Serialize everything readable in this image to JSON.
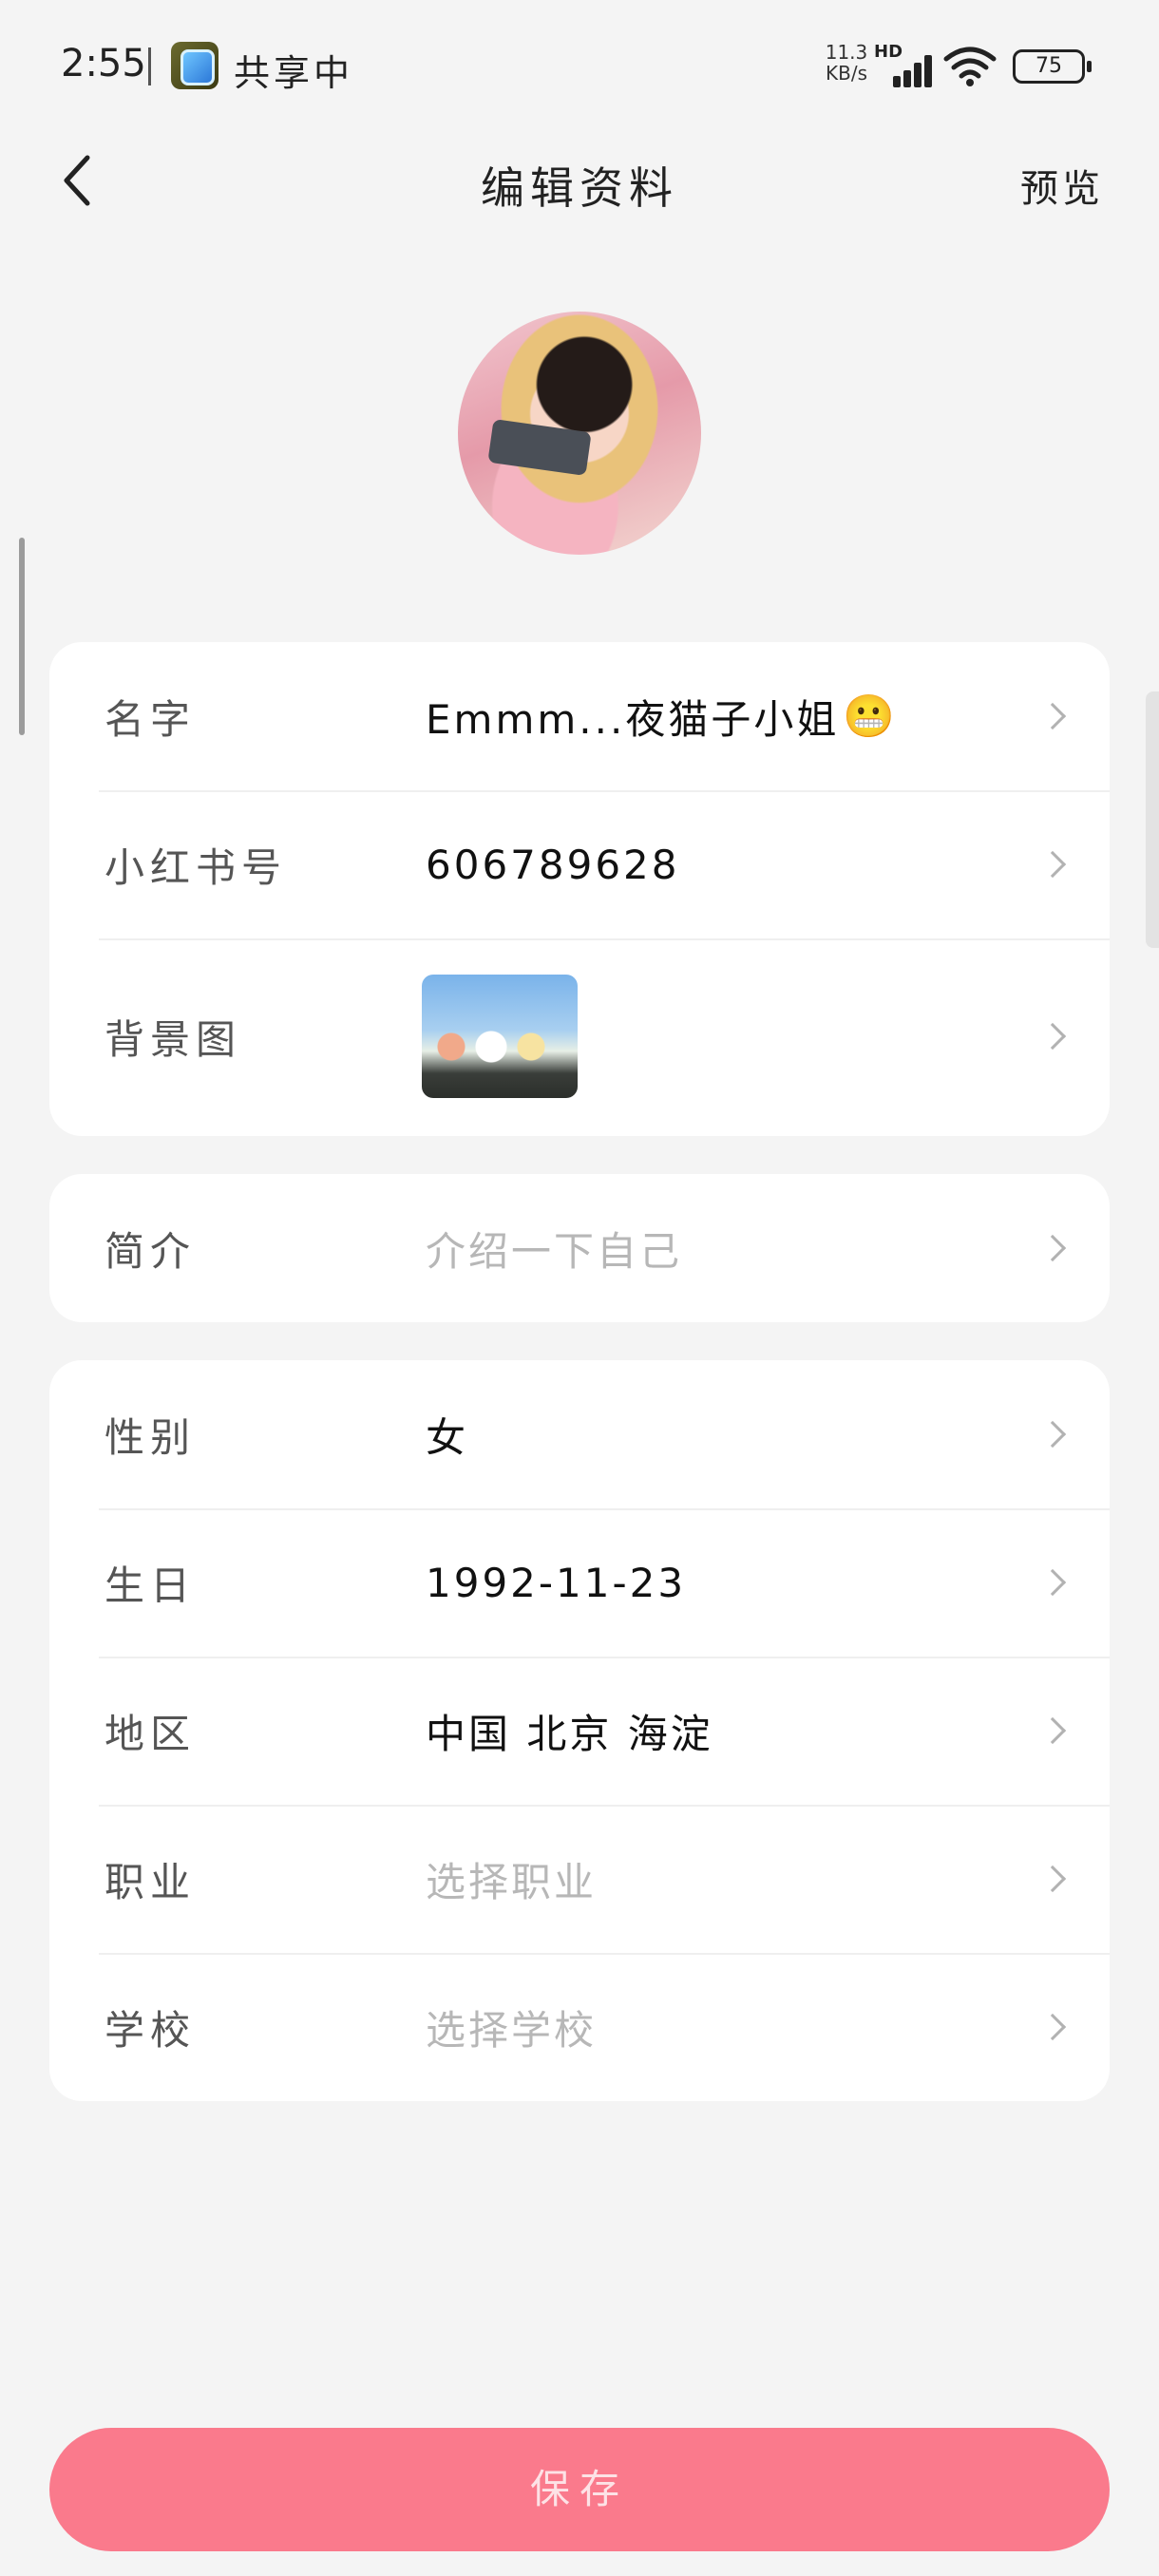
{
  "status_bar": {
    "time": "2:55",
    "share_text": "共享中",
    "speed_value": "11.3",
    "speed_unit": "KB/s",
    "network_badge": "HD",
    "battery": "75"
  },
  "header": {
    "title": "编辑资料",
    "preview_label": "预览"
  },
  "profile_card": {
    "rows": [
      {
        "label": "名字",
        "value": "Emmm...夜猫子小姐",
        "emoji": "😬"
      },
      {
        "label": "小红书号",
        "value": "606789628"
      },
      {
        "label": "背景图"
      }
    ]
  },
  "bio_card": {
    "label": "简介",
    "placeholder": "介绍一下自己"
  },
  "info_card": {
    "rows": [
      {
        "label": "性别",
        "value": "女"
      },
      {
        "label": "生日",
        "value": "1992-11-23"
      },
      {
        "label": "地区",
        "value": "中国 北京 海淀"
      },
      {
        "label": "职业",
        "placeholder": "选择职业"
      },
      {
        "label": "学校",
        "placeholder": "选择学校"
      }
    ]
  },
  "save_label": "保存",
  "colors": {
    "background": "#f4f4f4",
    "save_button": "#fa7a8c",
    "placeholder_text": "#b7b7b7"
  },
  "icons": [
    "back-arrow-icon",
    "chevron-right-icon",
    "wifi-icon",
    "signal-icon",
    "battery-icon",
    "share-app-icon"
  ]
}
